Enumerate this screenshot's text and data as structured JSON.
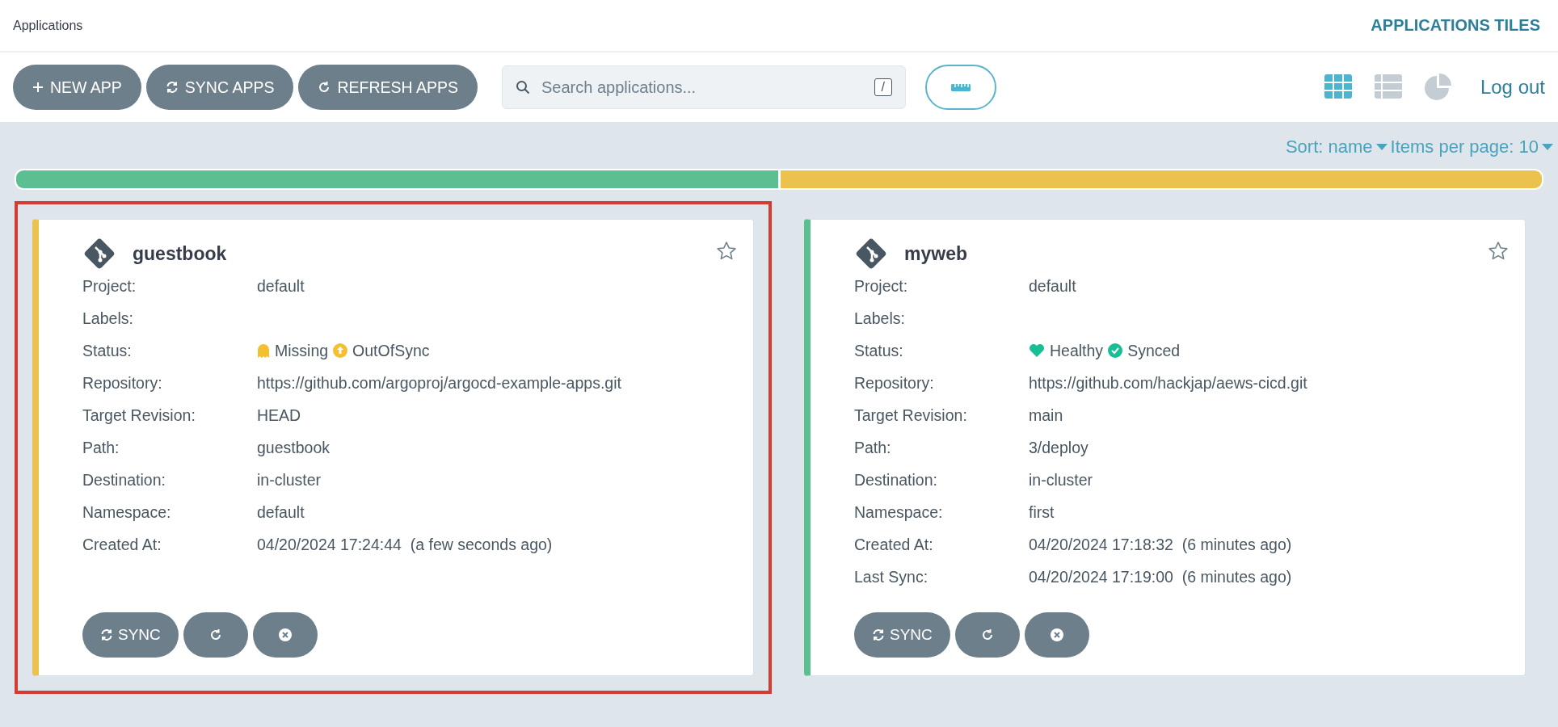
{
  "header": {
    "title": "Applications",
    "view_title": "APPLICATIONS TILES"
  },
  "toolbar": {
    "buttons": [
      {
        "kind": "new",
        "label": "NEW APP"
      },
      {
        "kind": "sync",
        "label": "SYNC APPS"
      },
      {
        "kind": "refresh",
        "label": "REFRESH APPS"
      }
    ],
    "search": {
      "placeholder": "Search applications...",
      "shortcut": "/"
    },
    "views": [
      {
        "kind": "tiles",
        "selected": true
      },
      {
        "kind": "list",
        "selected": false
      },
      {
        "kind": "summary",
        "selected": false
      }
    ],
    "logout": "Log out"
  },
  "sort": {
    "label": "Sort: name",
    "per_page": "Items per page: 10"
  },
  "status_bar": [
    {
      "color": "#5bbf92",
      "level": 0.5
    },
    {
      "color": "#ebc24e",
      "level": 0.5
    }
  ],
  "apps": [
    {
      "name": "guestbook",
      "color": "#ebc24e",
      "highlighted": true,
      "fields": [
        {
          "label": "Project:",
          "value": "default"
        },
        {
          "label": "Labels:"
        },
        {
          "label": "Status:",
          "health": {
            "kind": "missing",
            "text": "Missing"
          },
          "sync": {
            "kind": "outofsync",
            "text": "OutOfSync"
          }
        },
        {
          "label": "Repository:",
          "value": "https://github.com/argoproj/argocd-example-apps.git"
        },
        {
          "label": "Target Revision:",
          "value": "HEAD"
        },
        {
          "label": "Path:",
          "value": "guestbook"
        },
        {
          "label": "Destination:",
          "value": "in-cluster"
        },
        {
          "label": "Namespace:",
          "value": "default"
        },
        {
          "label": "Created At:",
          "value": "04/20/2024 17:24:44  (a few seconds ago)"
        }
      ],
      "actions": [
        {
          "kind": "sync",
          "label": "SYNC"
        },
        {
          "kind": "refresh"
        },
        {
          "kind": "delete"
        }
      ]
    },
    {
      "name": "myweb",
      "color": "#5bbf92",
      "highlighted": false,
      "fields": [
        {
          "label": "Project:",
          "value": "default"
        },
        {
          "label": "Labels:"
        },
        {
          "label": "Status:",
          "health": {
            "kind": "healthy",
            "text": "Healthy"
          },
          "sync": {
            "kind": "synced",
            "text": "Synced"
          }
        },
        {
          "label": "Repository:",
          "value": "https://github.com/hackjap/aews-cicd.git"
        },
        {
          "label": "Target Revision:",
          "value": "main"
        },
        {
          "label": "Path:",
          "value": "3/deploy"
        },
        {
          "label": "Destination:",
          "value": "in-cluster"
        },
        {
          "label": "Namespace:",
          "value": "first"
        },
        {
          "label": "Created At:",
          "value": "04/20/2024 17:18:32  (6 minutes ago)"
        },
        {
          "label": "Last Sync:",
          "value": "04/20/2024 17:19:00  (6 minutes ago)"
        }
      ],
      "actions": [
        {
          "kind": "sync",
          "label": "SYNC"
        },
        {
          "kind": "refresh"
        },
        {
          "kind": "delete"
        }
      ]
    }
  ]
}
